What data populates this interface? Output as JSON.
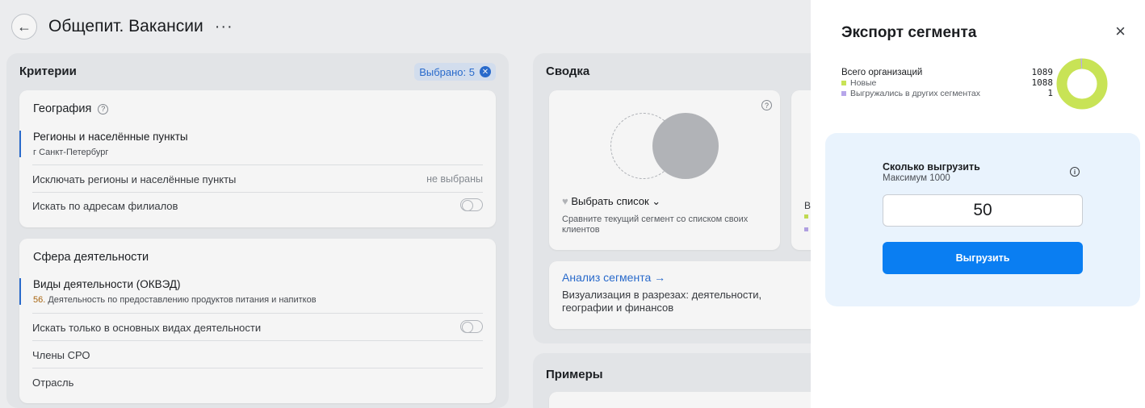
{
  "page": {
    "title": "Общепит. Вакансии",
    "back_icon": "←",
    "more_icon": "···"
  },
  "criteria": {
    "header": "Критерии",
    "selected_label": "Выбрано: 5",
    "geography": {
      "title": "География",
      "regions_label": "Регионы и населённые пункты",
      "regions_value": "г Санкт-Петербург",
      "exclude_label": "Исключать регионы и населённые пункты",
      "exclude_value": "не выбраны",
      "branches_label": "Искать по адресам филиалов"
    },
    "sphere": {
      "title": "Сфера деятельности",
      "okved_label": "Виды деятельности (ОКВЭД)",
      "okved_code": "56.",
      "okved_value": "Деятельность по предоставлению продуктов питания и напитков",
      "main_only_label": "Искать только в основных видах деятельности",
      "sro_label": "Члены СРО",
      "industry_label": "Отрасль"
    }
  },
  "summary": {
    "header": "Сводка",
    "pick_list": "Выбрать список ⌄",
    "pick_desc": "Сравните текущий сегмент со списком своих клиентов",
    "side_letter": "В",
    "analysis_title": "Анализ сегмента →",
    "analysis_desc": "Визуализация в разрезах: деятельности, географии и финансов"
  },
  "examples": {
    "header": "Примеры"
  },
  "export": {
    "title": "Экспорт сегмента",
    "close_icon": "×",
    "total_label": "Всего организаций",
    "total_value": "1089",
    "new_label": "Новые",
    "new_value": "1088",
    "other_label": "Выгружались в других сегментах",
    "other_value": "1",
    "how_many_label": "Сколько выгрузить",
    "max_label": "Максимум 1000",
    "quantity_value": "50",
    "submit_label": "Выгрузить",
    "colors": {
      "new": "#c8e356",
      "other": "#b7a6ea",
      "primary": "#0a7ef2"
    }
  }
}
